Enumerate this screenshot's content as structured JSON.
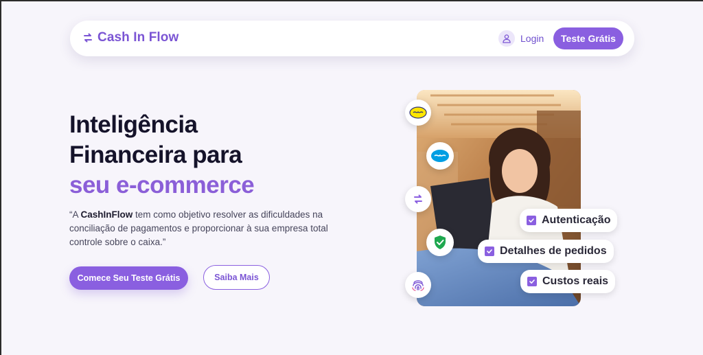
{
  "navbar": {
    "brand": "Cash In Flow",
    "login_label": "Login",
    "trial_label": "Teste Grátis"
  },
  "hero": {
    "title_line1": "Inteligência",
    "title_line2": "Financeira para",
    "title_line3": "seu e-commerce",
    "desc_prefix": "“A ",
    "desc_brand": "CashInFlow",
    "desc_rest": " tem como objetivo resolver as dificuldades na conciliação de pagamentos e proporcionar à sua empresa total controle sobre o caixa.”",
    "cta_primary": "Comece Seu Teste Grátis",
    "cta_secondary": "Saiba Mais"
  },
  "feature_badges": [
    {
      "label": "Autenticação"
    },
    {
      "label": "Detalhes de pedidos"
    },
    {
      "label": "Custos reais"
    }
  ],
  "integration_icons": [
    "mercado-livre-icon",
    "mercado-pago-icon",
    "cash-flow-icon",
    "shield-check-icon",
    "fingerprint-icon"
  ],
  "colors": {
    "accent": "#8a5fe0",
    "brand_text": "#7b55d4",
    "background": "#f7f5fb",
    "heading": "#15132a"
  }
}
